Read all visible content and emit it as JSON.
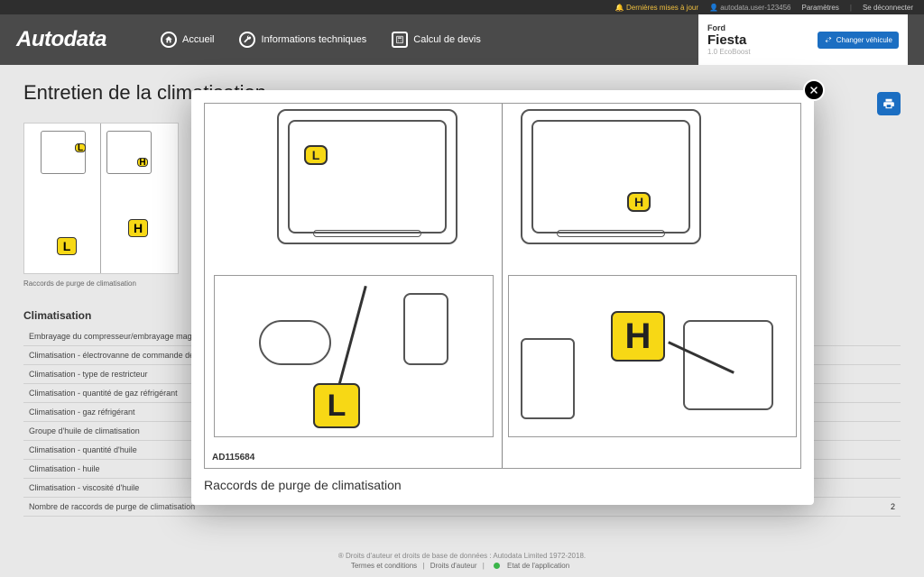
{
  "topbar": {
    "updates": "Dernières mises à jour",
    "user": "autodata.user-123456",
    "settings": "Paramètres",
    "logout": "Se déconnecter"
  },
  "brand": "Autodata",
  "nav": {
    "home": "Accueil",
    "tech": "Informations techniques",
    "quote": "Calcul de devis"
  },
  "vehicle": {
    "make": "Ford",
    "model": "Fiesta",
    "engine": "1.0 EcoBoost",
    "change": "Changer véhicule"
  },
  "page_title": "Entretien de la climatisation",
  "thumb_caption": "Raccords de purge de climatisation",
  "section_title": "Climatisation",
  "specs": [
    {
      "label": "Embrayage du compresseur/embrayage magnétique",
      "value": ""
    },
    {
      "label": "Climatisation - électrovanne de commande de capacité",
      "value": ""
    },
    {
      "label": "Climatisation - type de restricteur",
      "value": ""
    },
    {
      "label": "Climatisation - quantité de gaz réfrigérant",
      "value": ""
    },
    {
      "label": "Climatisation - gaz réfrigérant",
      "value": ""
    },
    {
      "label": "Groupe d'huile de climatisation",
      "value": ""
    },
    {
      "label": "Climatisation - quantité d'huile",
      "value": ""
    },
    {
      "label": "Climatisation - huile",
      "value": ""
    },
    {
      "label": "Climatisation - viscosité d'huile",
      "value": ""
    },
    {
      "label": "Nombre de raccords de purge de climatisation",
      "value": "2"
    }
  ],
  "modal": {
    "diagram_id": "AD115684",
    "caption": "Raccords de purge de climatisation",
    "label_low": "L",
    "label_high": "H"
  },
  "footer": {
    "copyright": "® Droits d'auteur et droits de base de données : Autodata Limited 1972-2018.",
    "terms": "Termes et conditions",
    "rights": "Droits d'auteur",
    "status": "Etat de l'application"
  }
}
